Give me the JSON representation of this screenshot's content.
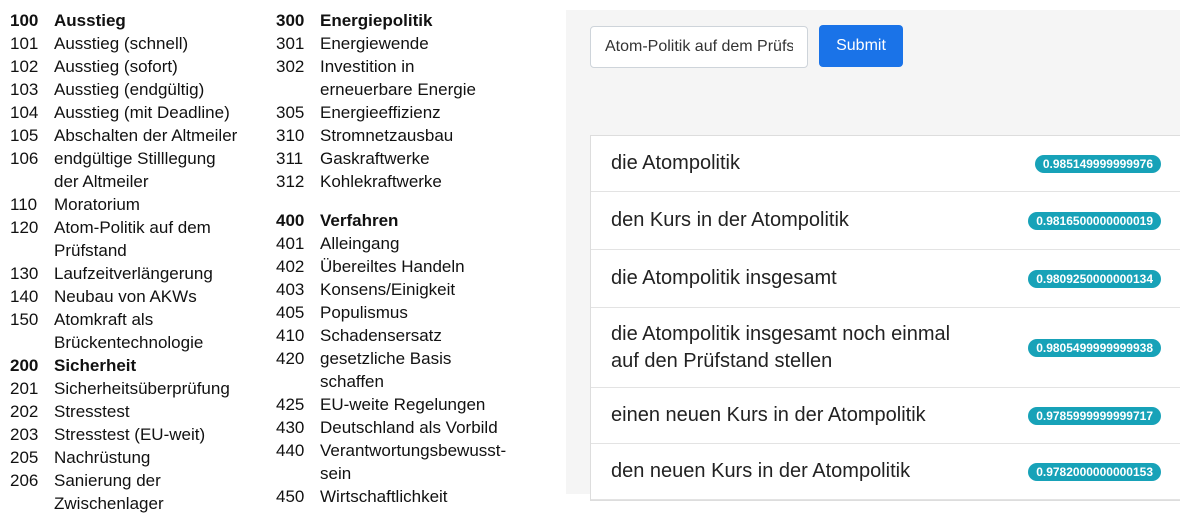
{
  "codes": {
    "col1": [
      {
        "num": "100",
        "label": "Ausstieg",
        "head": true
      },
      {
        "num": "101",
        "label": "Ausstieg (schnell)"
      },
      {
        "num": "102",
        "label": "Ausstieg (sofort)"
      },
      {
        "num": "103",
        "label": "Ausstieg (endgültig)"
      },
      {
        "num": "104",
        "label": "Ausstieg (mit Deadline)"
      },
      {
        "num": "105",
        "label": "Abschalten der Altmeiler"
      },
      {
        "num": "106",
        "label": "endgültige Stilllegung"
      },
      {
        "num": "",
        "label": "der Altmeiler",
        "cont": true
      },
      {
        "num": "110",
        "label": "Moratorium"
      },
      {
        "num": "120",
        "label": "Atom-Politik auf dem"
      },
      {
        "num": "",
        "label": "Prüfstand",
        "cont": true
      },
      {
        "num": "130",
        "label": "Laufzeitverlängerung"
      },
      {
        "num": "140",
        "label": "Neubau von AKWs"
      },
      {
        "num": "150",
        "label": "Atomkraft als"
      },
      {
        "num": "",
        "label": "Brückentechnologie",
        "cont": true
      },
      {
        "num": "200",
        "label": "Sicherheit",
        "head": true
      },
      {
        "num": "201",
        "label": "Sicherheitsüberprüfung"
      },
      {
        "num": "202",
        "label": "Stresstest"
      },
      {
        "num": "203",
        "label": "Stresstest (EU-weit)"
      },
      {
        "num": "205",
        "label": "Nachrüstung"
      },
      {
        "num": "206",
        "label": "Sanierung der"
      },
      {
        "num": "",
        "label": "Zwischenlager",
        "cont": true
      }
    ],
    "col2a": [
      {
        "num": "300",
        "label": "Energiepolitik",
        "head": true
      },
      {
        "num": "301",
        "label": "Energiewende"
      },
      {
        "num": "302",
        "label": "Investition in"
      },
      {
        "num": "",
        "label": "erneuerbare Energie",
        "cont": true
      },
      {
        "num": "305",
        "label": "Energieeffizienz"
      },
      {
        "num": "310",
        "label": "Stromnetzausbau"
      },
      {
        "num": "311",
        "label": "Gaskraftwerke"
      },
      {
        "num": "312",
        "label": "Kohlekraftwerke"
      }
    ],
    "col2b": [
      {
        "num": "400",
        "label": "Verfahren",
        "head": true
      },
      {
        "num": "401",
        "label": "Alleingang"
      },
      {
        "num": "402",
        "label": "Übereiltes Handeln"
      },
      {
        "num": "403",
        "label": "Konsens/Einigkeit"
      },
      {
        "num": "405",
        "label": "Populismus"
      },
      {
        "num": "410",
        "label": "Schadensersatz"
      },
      {
        "num": "420",
        "label": "gesetzliche Basis"
      },
      {
        "num": "",
        "label": "schaffen",
        "cont": true
      },
      {
        "num": "425",
        "label": "EU-weite Regelungen"
      },
      {
        "num": "430",
        "label": "Deutschland als Vorbild"
      },
      {
        "num": "440",
        "label": "Verantwortungsbewusst-"
      },
      {
        "num": "",
        "label": "sein",
        "cont": true
      },
      {
        "num": "450",
        "label": "Wirtschaftlichkeit"
      }
    ]
  },
  "search": {
    "value": "Atom-Politik auf dem Prüfstand",
    "submit_label": "Submit"
  },
  "results": [
    {
      "text": "die Atompolitik",
      "score": "0.985149999999976"
    },
    {
      "text": "den Kurs in der Atompolitik",
      "score": "0.9816500000000019"
    },
    {
      "text": "die Atompolitik insgesamt",
      "score": "0.9809250000000134"
    },
    {
      "text": "die Atompolitik insgesamt noch einmal auf den Prüfstand stellen",
      "score": "0.9805499999999938"
    },
    {
      "text": "einen neuen Kurs in der Atompolitik",
      "score": "0.9785999999999717"
    },
    {
      "text": "den neuen Kurs in der Atompolitik",
      "score": "0.9782000000000153"
    }
  ],
  "colors": {
    "badge": "#17a2b8",
    "submit": "#1a73e8"
  }
}
